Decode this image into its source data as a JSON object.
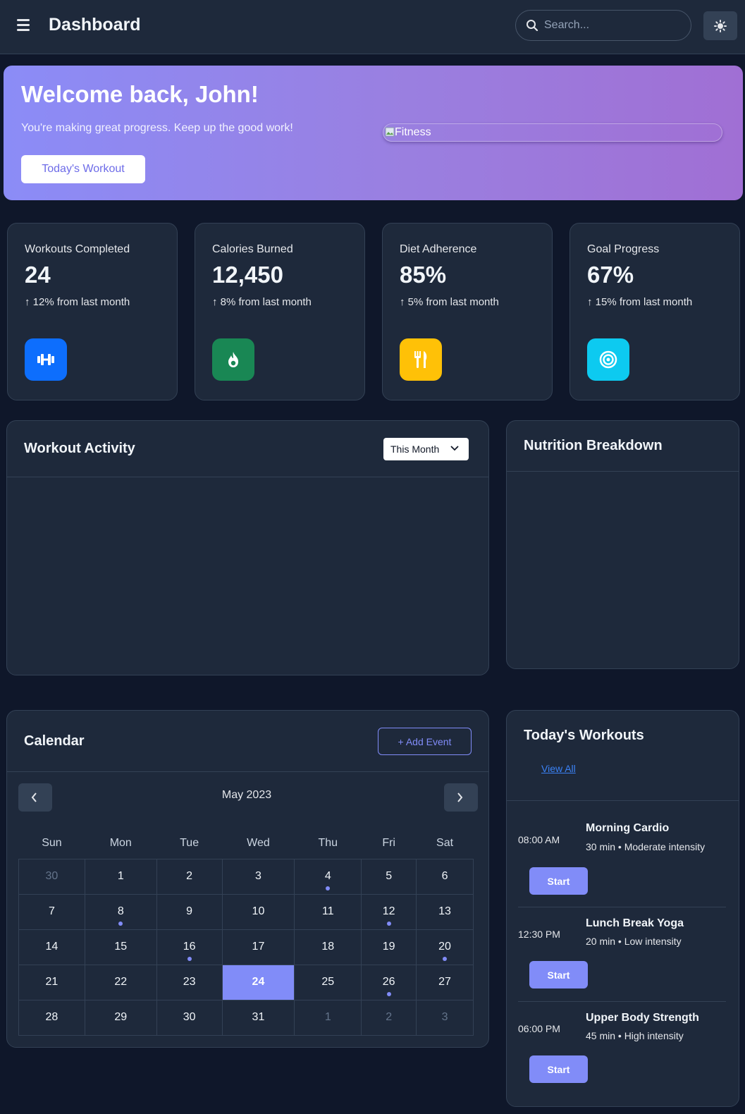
{
  "header": {
    "title": "Dashboard",
    "search_placeholder": "Search...",
    "icons": {
      "menu": "hamburger-icon",
      "search": "search-icon",
      "theme": "sun-icon"
    }
  },
  "banner": {
    "title": "Welcome back, John!",
    "subtitle": "You're making great progress. Keep up the good work!",
    "cta": "Today's Workout",
    "image_alt": "Fitness"
  },
  "stats": [
    {
      "label": "Workouts Completed",
      "value": "24",
      "change": "12% from last month",
      "icon": "dumbbell-icon",
      "color": "#0d6efd"
    },
    {
      "label": "Calories Burned",
      "value": "12,450",
      "change": "8% from last month",
      "icon": "fire-icon",
      "color": "#198754"
    },
    {
      "label": "Diet Adherence",
      "value": "85%",
      "change": "5% from last month",
      "icon": "utensils-icon",
      "color": "#ffc107"
    },
    {
      "label": "Goal Progress",
      "value": "67%",
      "change": "15% from last month",
      "icon": "target-icon",
      "color": "#0dcaf0"
    }
  ],
  "workout_activity": {
    "title": "Workout Activity",
    "period": "This Month"
  },
  "nutrition": {
    "title": "Nutrition Breakdown"
  },
  "calendar": {
    "title": "Calendar",
    "add_event": "Add Event",
    "month": "May 2023",
    "weekdays": [
      "Sun",
      "Mon",
      "Tue",
      "Wed",
      "Thu",
      "Fri",
      "Sat"
    ],
    "weeks": [
      [
        {
          "d": "30",
          "muted": true
        },
        {
          "d": "1"
        },
        {
          "d": "2"
        },
        {
          "d": "3"
        },
        {
          "d": "4",
          "event": true
        },
        {
          "d": "5"
        },
        {
          "d": "6"
        }
      ],
      [
        {
          "d": "7"
        },
        {
          "d": "8",
          "event": true
        },
        {
          "d": "9"
        },
        {
          "d": "10"
        },
        {
          "d": "11"
        },
        {
          "d": "12",
          "event": true
        },
        {
          "d": "13"
        }
      ],
      [
        {
          "d": "14"
        },
        {
          "d": "15"
        },
        {
          "d": "16",
          "event": true
        },
        {
          "d": "17"
        },
        {
          "d": "18"
        },
        {
          "d": "19"
        },
        {
          "d": "20",
          "event": true
        }
      ],
      [
        {
          "d": "21"
        },
        {
          "d": "22"
        },
        {
          "d": "23"
        },
        {
          "d": "24",
          "today": true
        },
        {
          "d": "25"
        },
        {
          "d": "26",
          "event": true
        },
        {
          "d": "27"
        }
      ],
      [
        {
          "d": "28"
        },
        {
          "d": "29"
        },
        {
          "d": "30"
        },
        {
          "d": "31"
        },
        {
          "d": "1",
          "muted": true
        },
        {
          "d": "2",
          "muted": true
        },
        {
          "d": "3",
          "muted": true
        }
      ]
    ],
    "accent": "#818cf8"
  },
  "todays_workouts": {
    "title": "Today's Workouts",
    "view_all": "View All",
    "items": [
      {
        "time": "08:00 AM",
        "name": "Morning Cardio",
        "meta": "30 min • Moderate intensity",
        "action": "Start"
      },
      {
        "time": "12:30 PM",
        "name": "Lunch Break Yoga",
        "meta": "20 min • Low intensity",
        "action": "Start"
      },
      {
        "time": "06:00 PM",
        "name": "Upper Body Strength",
        "meta": "45 min • High intensity",
        "action": "Start"
      }
    ]
  }
}
